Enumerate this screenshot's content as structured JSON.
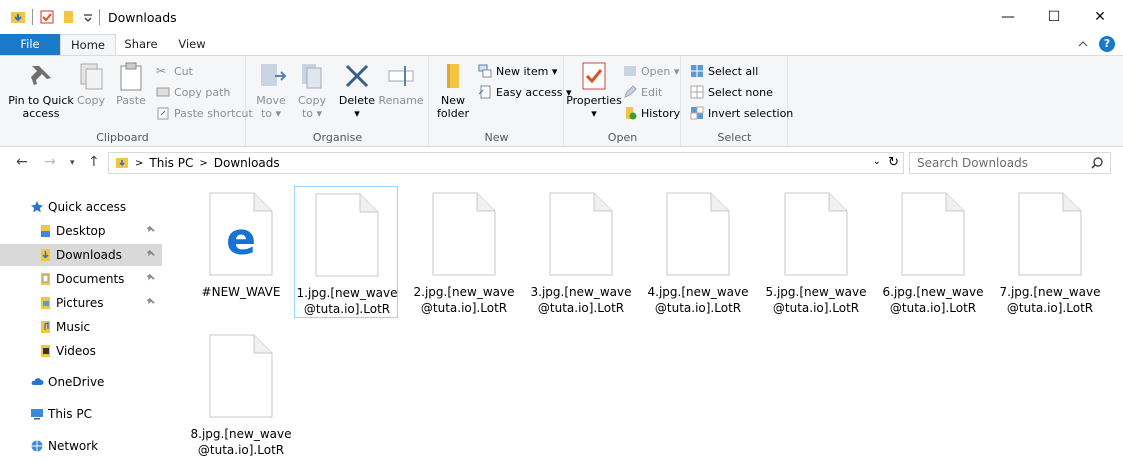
{
  "window": {
    "title": "Downloads",
    "minimize": "—",
    "maximize": "☐",
    "close": "✕"
  },
  "tabs": {
    "file": "File",
    "home": "Home",
    "share": "Share",
    "view": "View",
    "collapse": "^",
    "help": "?"
  },
  "ribbon": {
    "clipboard": {
      "label": "Clipboard",
      "pin": "Pin to Quick\naccess",
      "copy": "Copy",
      "paste": "Paste",
      "cut": "Cut",
      "copy_path": "Copy path",
      "paste_shortcut": "Paste shortcut"
    },
    "organise": {
      "label": "Organise",
      "move_to": "Move\nto ▾",
      "copy_to": "Copy\nto ▾",
      "delete": "Delete\n▾",
      "rename": "Rename"
    },
    "new": {
      "label": "New",
      "new_folder": "New\nfolder",
      "new_item": "New item ▾",
      "easy_access": "Easy access ▾"
    },
    "open": {
      "label": "Open",
      "properties": "Properties\n▾",
      "open": "Open ▾",
      "edit": "Edit",
      "history": "History"
    },
    "select": {
      "label": "Select",
      "select_all": "Select all",
      "select_none": "Select none",
      "invert": "Invert selection"
    }
  },
  "address": {
    "crumbs": [
      "This PC",
      "Downloads"
    ],
    "search_placeholder": "Search Downloads"
  },
  "nav": {
    "items": [
      {
        "label": "Quick access",
        "icon": "star-icon",
        "pinned": false
      },
      {
        "label": "Desktop",
        "icon": "desktop-folder-icon",
        "pinned": true
      },
      {
        "label": "Downloads",
        "icon": "downloads-folder-icon",
        "pinned": true,
        "selected": true
      },
      {
        "label": "Documents",
        "icon": "documents-folder-icon",
        "pinned": true
      },
      {
        "label": "Pictures",
        "icon": "pictures-folder-icon",
        "pinned": true
      },
      {
        "label": "Music",
        "icon": "music-folder-icon",
        "pinned": false
      },
      {
        "label": "Videos",
        "icon": "videos-folder-icon",
        "pinned": false
      },
      {
        "label": "OneDrive",
        "icon": "cloud-icon",
        "pinned": false
      },
      {
        "label": "This PC",
        "icon": "computer-icon",
        "pinned": false
      },
      {
        "label": "Network",
        "icon": "network-icon",
        "pinned": false
      }
    ]
  },
  "files": [
    {
      "name": "#NEW_WAVE",
      "icon": "edge-html-icon"
    },
    {
      "name": "1.jpg.[new_wave\n@tuta.io].LotR",
      "icon": "blank-file-icon",
      "selected": true
    },
    {
      "name": "2.jpg.[new_wave\n@tuta.io].LotR",
      "icon": "blank-file-icon"
    },
    {
      "name": "3.jpg.[new_wave\n@tuta.io].LotR",
      "icon": "blank-file-icon"
    },
    {
      "name": "4.jpg.[new_wave\n@tuta.io].LotR",
      "icon": "blank-file-icon"
    },
    {
      "name": "5.jpg.[new_wave\n@tuta.io].LotR",
      "icon": "blank-file-icon"
    },
    {
      "name": "6.jpg.[new_wave\n@tuta.io].LotR",
      "icon": "blank-file-icon"
    },
    {
      "name": "7.jpg.[new_wave\n@tuta.io].LotR",
      "icon": "blank-file-icon"
    },
    {
      "name": "8.jpg.[new_wave\n@tuta.io].LotR",
      "icon": "blank-file-icon"
    }
  ],
  "colors": {
    "accent": "#1979ca",
    "selection": "#cce8ff",
    "nav_selected": "#d9d9d9"
  }
}
